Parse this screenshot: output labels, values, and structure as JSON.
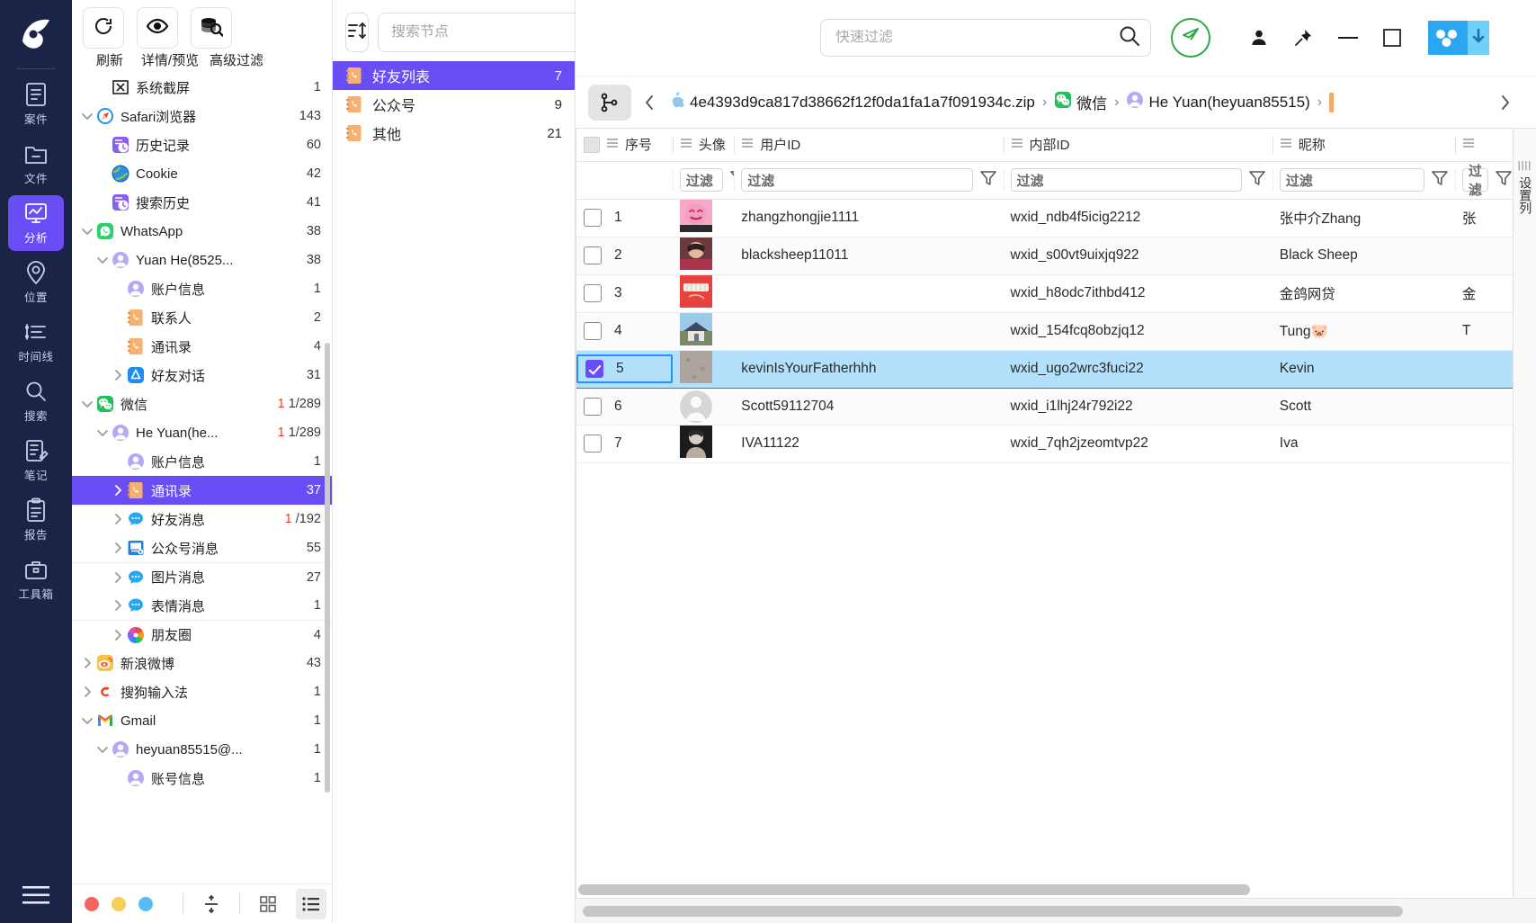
{
  "rail": {
    "logo_icon": "app-logo-icon",
    "items": [
      {
        "label": "案件",
        "icon": "case-icon",
        "active": false
      },
      {
        "label": "文件",
        "icon": "file-icon",
        "active": false
      },
      {
        "label": "分析",
        "icon": "analysis-icon",
        "active": true
      },
      {
        "label": "位置",
        "icon": "location-icon",
        "active": false
      },
      {
        "label": "时间线",
        "icon": "timeline-icon",
        "active": false
      },
      {
        "label": "搜索",
        "icon": "search-icon",
        "active": false
      },
      {
        "label": "笔记",
        "icon": "note-icon",
        "active": false
      },
      {
        "label": "报告",
        "icon": "report-icon",
        "active": false
      },
      {
        "label": "工具箱",
        "icon": "toolbox-icon",
        "active": false
      }
    ],
    "menu_icon": "hamburger-menu-icon"
  },
  "tree_toolbar": {
    "buttons": [
      {
        "label": "刷新",
        "icon": "refresh-icon"
      },
      {
        "label": "详情/预览",
        "icon": "eye-icon"
      },
      {
        "label": "高级过滤",
        "icon": "advanced-filter-icon"
      }
    ]
  },
  "tree": {
    "nodes": [
      {
        "label": "系统截屏",
        "count": "1",
        "indent": 1,
        "arrow": "",
        "icon": "screenshot-icon",
        "sel": false
      },
      {
        "label": "Safari浏览器",
        "count": "143",
        "indent": 0,
        "arrow": "down",
        "icon": "safari-icon",
        "sel": false
      },
      {
        "label": "历史记录",
        "count": "60",
        "indent": 1,
        "arrow": "",
        "icon": "history-icon",
        "sel": false
      },
      {
        "label": "Cookie",
        "count": "42",
        "indent": 1,
        "arrow": "",
        "icon": "cookie-icon",
        "sel": false
      },
      {
        "label": "搜索历史",
        "count": "41",
        "indent": 1,
        "arrow": "",
        "icon": "history-icon",
        "sel": false
      },
      {
        "label": "WhatsApp",
        "count": "38",
        "indent": 0,
        "arrow": "down",
        "icon": "whatsapp-icon",
        "sel": false
      },
      {
        "label": "Yuan He(8525...",
        "count": "38",
        "indent": 1,
        "arrow": "down",
        "icon": "user-icon",
        "sel": false
      },
      {
        "label": "账户信息",
        "count": "1",
        "indent": 2,
        "arrow": "",
        "icon": "user-icon",
        "sel": false
      },
      {
        "label": "联系人",
        "count": "2",
        "indent": 2,
        "arrow": "",
        "icon": "contacts-icon",
        "sel": false
      },
      {
        "label": "通讯录",
        "count": "4",
        "indent": 2,
        "arrow": "",
        "icon": "contacts-icon",
        "sel": false
      },
      {
        "label": "好友对话",
        "count": "31",
        "indent": 2,
        "arrow": "right",
        "icon": "appstore-icon",
        "sel": false
      },
      {
        "label": "微信",
        "count": "1/289",
        "count_red": "1",
        "indent": 0,
        "arrow": "down",
        "icon": "wechat-icon",
        "sel": false
      },
      {
        "label": "He Yuan(he...",
        "count": "1/289",
        "count_red": "1",
        "indent": 1,
        "arrow": "down",
        "icon": "user-icon",
        "sel": false
      },
      {
        "label": "账户信息",
        "count": "1",
        "indent": 2,
        "arrow": "",
        "icon": "user-icon",
        "sel": false
      },
      {
        "label": "通讯录",
        "count": "37",
        "indent": 2,
        "arrow": "right",
        "icon": "contacts-icon",
        "sel": true
      },
      {
        "label": "好友消息",
        "count": "/192",
        "count_red": "1",
        "indent": 2,
        "arrow": "right",
        "icon": "chat-icon",
        "sel": false
      },
      {
        "label": "公众号消息",
        "count": "55",
        "indent": 2,
        "arrow": "right",
        "icon": "official-account-icon",
        "sel": false
      },
      {
        "label": "图片消息",
        "count": "27",
        "indent": 2,
        "arrow": "right",
        "icon": "chat-icon",
        "sel": false,
        "divider": true
      },
      {
        "label": "表情消息",
        "count": "1",
        "indent": 2,
        "arrow": "right",
        "icon": "chat-icon",
        "sel": false
      },
      {
        "label": "朋友圈",
        "count": "4",
        "indent": 2,
        "arrow": "right",
        "icon": "moments-icon",
        "sel": false,
        "divider": true
      },
      {
        "label": "新浪微博",
        "count": "43",
        "indent": 0,
        "arrow": "right",
        "icon": "weibo-icon",
        "sel": false
      },
      {
        "label": "搜狗输入法",
        "count": "1",
        "indent": 0,
        "arrow": "right",
        "icon": "sogou-icon",
        "sel": false
      },
      {
        "label": "Gmail",
        "count": "1",
        "indent": 0,
        "arrow": "down",
        "icon": "gmail-icon",
        "sel": false
      },
      {
        "label": "heyuan85515@...",
        "count": "1",
        "indent": 1,
        "arrow": "down",
        "icon": "user-icon",
        "sel": false
      },
      {
        "label": "账号信息",
        "count": "1",
        "indent": 2,
        "arrow": "",
        "icon": "user-icon",
        "sel": false
      }
    ]
  },
  "tree_footer": {
    "dots": [
      {
        "name": "flag-red",
        "color": "#f4655e"
      },
      {
        "name": "flag-yellow",
        "color": "#f7cf56"
      },
      {
        "name": "flag-blue",
        "color": "#58bdf2"
      }
    ],
    "buttons": [
      {
        "icon": "collapse-expand-icon",
        "active": false
      },
      {
        "icon": "grid-view-icon",
        "active": false
      },
      {
        "icon": "list-view-icon",
        "active": true
      }
    ]
  },
  "node_panel": {
    "sort_icon": "sort-icon",
    "search_placeholder": "搜索节点",
    "search_value": "",
    "search_icon": "search-icon",
    "items": [
      {
        "label": "好友列表",
        "count": "7",
        "icon": "contacts-icon",
        "sel": true
      },
      {
        "label": "公众号",
        "count": "9",
        "icon": "contacts-icon",
        "sel": false
      },
      {
        "label": "其他",
        "count": "21",
        "icon": "contacts-icon",
        "sel": false
      }
    ]
  },
  "topbar": {
    "quick_filter_placeholder": "快速过滤",
    "quick_filter_value": "",
    "search_icon": "search-icon",
    "send_icon": "send-telegram-icon",
    "user_icon": "user-account-icon",
    "pin_icon": "pin-icon",
    "minimize_icon": "minimize-icon",
    "maximize_icon": "maximize-icon",
    "netdisk_icon": "baidu-netdisk-download-icon"
  },
  "breadcrumb": {
    "graph_icon": "node-graph-icon",
    "back_icon": "chevron-left-icon",
    "forward_icon": "chevron-right-icon",
    "items": [
      {
        "label": "4e4393d9ca817d38662f12f0da1fa1a7f091934c.zip",
        "icon": "apple-icon"
      },
      {
        "label": "微信",
        "icon": "wechat-icon"
      },
      {
        "label": "He Yuan(heyuan85515)",
        "icon": "user-icon"
      },
      {
        "label": "",
        "icon": "orange-bar-icon"
      }
    ]
  },
  "table": {
    "columns": [
      {
        "key": "index",
        "label": "序号",
        "icon": "column-menu-icon"
      },
      {
        "key": "avatar",
        "label": "头像",
        "icon": "column-menu-icon"
      },
      {
        "key": "userid",
        "label": "用户ID",
        "icon": "column-menu-icon"
      },
      {
        "key": "innerid",
        "label": "内部ID",
        "icon": "column-menu-icon"
      },
      {
        "key": "nickname",
        "label": "昵称",
        "icon": "column-menu-icon"
      },
      {
        "key": "extra",
        "label": "",
        "icon": "column-menu-icon"
      }
    ],
    "filter_placeholder": "过滤",
    "filter_icon": "funnel-icon",
    "header_checkbox_checked": false,
    "rows": [
      {
        "index": "1",
        "avatar": "avatar-pink-smiley",
        "userid": "zhangzhongjie1111",
        "innerid": "wxid_ndb4f5icig2212",
        "nickname": "张中介Zhang",
        "extra": "张",
        "checked": false,
        "selected": false
      },
      {
        "index": "2",
        "avatar": "avatar-girl-photo",
        "userid": "blacksheep11011",
        "innerid": "wxid_s00vt9uixjq922",
        "nickname": "Black Sheep",
        "extra": "",
        "checked": false,
        "selected": false
      },
      {
        "index": "3",
        "avatar": "avatar-red-candy",
        "userid": "",
        "innerid": "wxid_h8odc7ithbd412",
        "nickname": "金鸽网贷",
        "extra": "金",
        "checked": false,
        "selected": false
      },
      {
        "index": "4",
        "avatar": "avatar-house-photo",
        "userid": "",
        "innerid": "wxid_154fcq8obzjq12",
        "nickname": "Tung🐷",
        "extra": "T",
        "checked": false,
        "selected": false
      },
      {
        "index": "5",
        "avatar": "avatar-gray-texture",
        "userid": "kevinIsYourFatherhhh",
        "innerid": "wxid_ugo2wrc3fuci22",
        "nickname": "Kevin",
        "extra": "",
        "checked": true,
        "selected": true
      },
      {
        "index": "6",
        "avatar": "avatar-default-person",
        "userid": "Scott59112704",
        "innerid": "wxid_i1lhj24r792i22",
        "nickname": "Scott",
        "extra": "",
        "checked": false,
        "selected": false
      },
      {
        "index": "7",
        "avatar": "avatar-portrait-photo",
        "userid": "IVA11122",
        "innerid": "wxid_7qh2jzeomtvp22",
        "nickname": "Iva",
        "extra": "",
        "checked": false,
        "selected": false
      }
    ],
    "col_settings_label": "设置列"
  },
  "colors": {
    "accent": "#6b4df6",
    "rail_bg": "#1b2346",
    "row_selected": "#b3e1fb",
    "count_alert": "#e8402a"
  }
}
